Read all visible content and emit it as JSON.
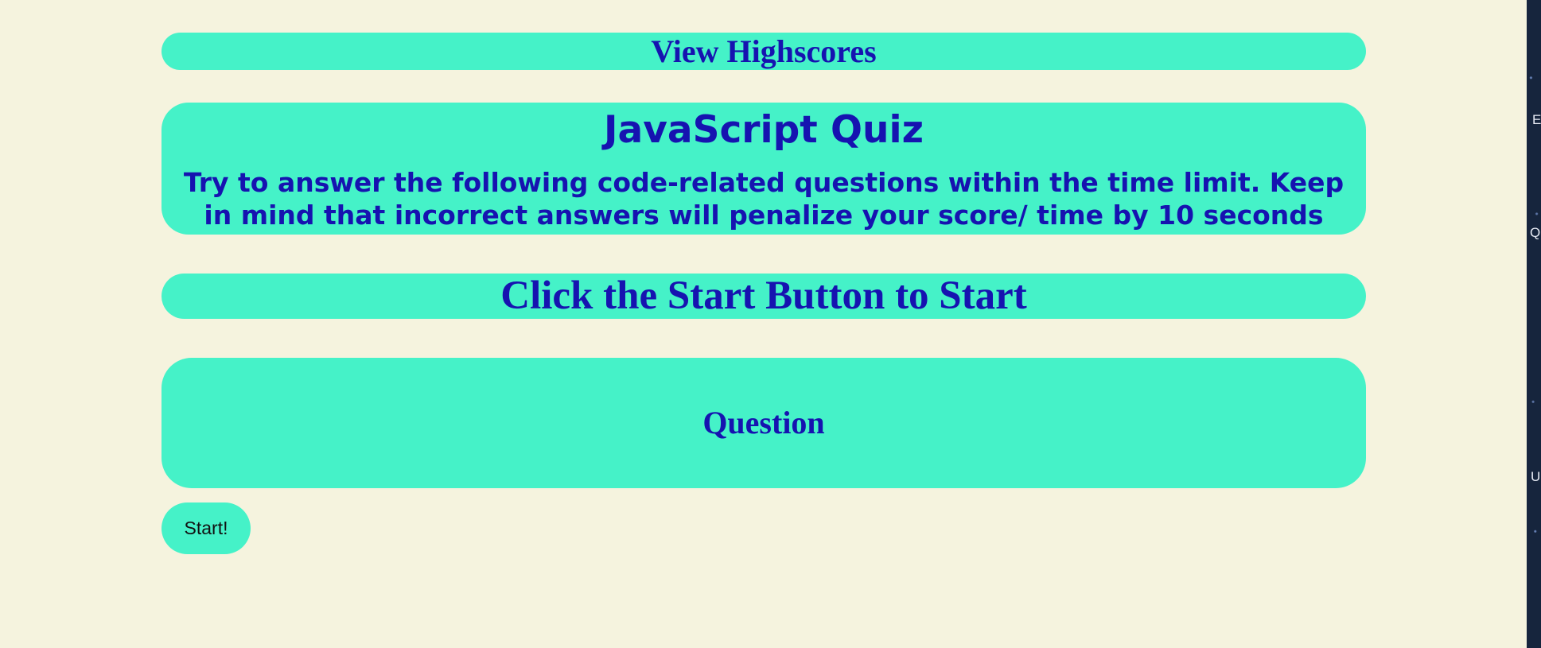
{
  "header": {
    "highscores_label": "View Highscores"
  },
  "intro": {
    "title": "JavaScript Quiz",
    "description": "Try to answer the following code-related questions within the time limit. Keep in mind that incorrect answers will penalize your score/ time by 10 seconds"
  },
  "status": {
    "message": "Click the Start Button to Start"
  },
  "quiz": {
    "question_label": "Question"
  },
  "controls": {
    "start_label": "Start!"
  },
  "background_edge": {
    "letters": [
      "E",
      "Q",
      "U"
    ]
  },
  "colors": {
    "page_background": "#f5f3de",
    "panel_background": "#45f2c8",
    "text_primary": "#1613b0",
    "button_text": "#111111",
    "side_background": "#16253d"
  }
}
